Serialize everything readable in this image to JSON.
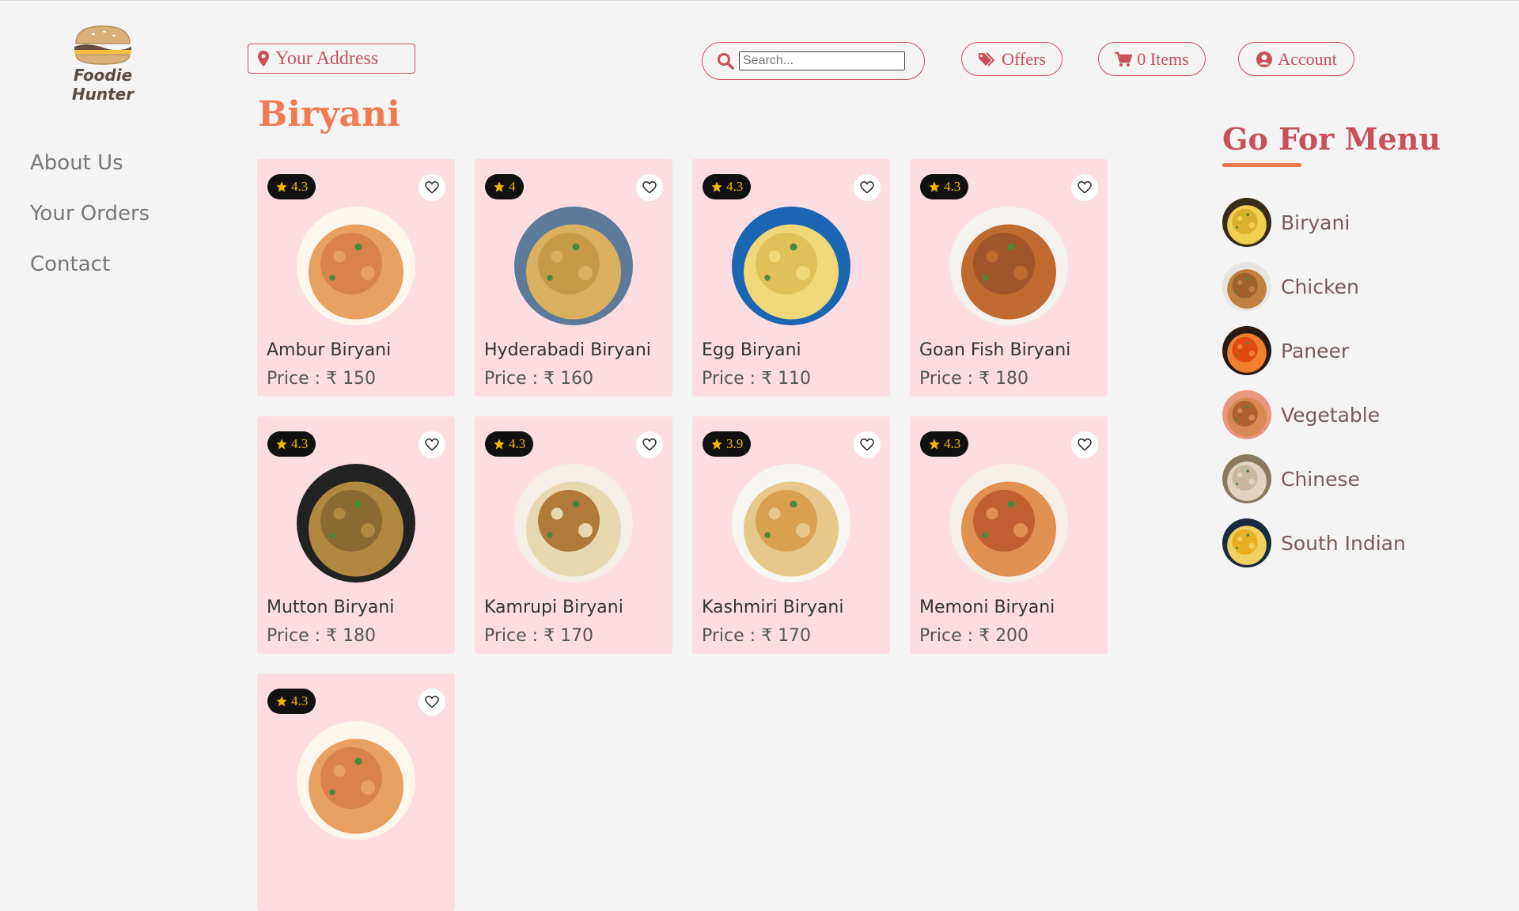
{
  "brand": {
    "name": "Foodie Hunter"
  },
  "header": {
    "address_label": "Your Address",
    "search_placeholder": "Search...",
    "offers_label": "Offers",
    "cart_label": "0 Items",
    "account_label": "Account"
  },
  "left_nav": [
    "About Us",
    "Your Orders",
    "Contact"
  ],
  "section_title": "Biryani",
  "price_prefix": "Price : ₹",
  "items": [
    {
      "name": "Ambur Biryani",
      "price": "150",
      "rating": "4.3",
      "palette": [
        "#d9824a",
        "#e8a060",
        "#fff6ee"
      ]
    },
    {
      "name": "Hyderabadi Biryani",
      "price": "160",
      "rating": "4",
      "palette": [
        "#c79a4a",
        "#d9b060",
        "#5c7a99"
      ]
    },
    {
      "name": "Egg Biryani",
      "price": "110",
      "rating": "4.3",
      "palette": [
        "#e0c058",
        "#f0d878",
        "#1b66b3"
      ]
    },
    {
      "name": "Goan Fish Biryani",
      "price": "180",
      "rating": "4.3",
      "palette": [
        "#a0552a",
        "#c06a30",
        "#f4f2ee"
      ]
    },
    {
      "name": "Mutton Biryani",
      "price": "180",
      "rating": "4.3",
      "palette": [
        "#8a6a30",
        "#b08840",
        "#222222"
      ]
    },
    {
      "name": "Kamrupi Biryani",
      "price": "170",
      "rating": "4.3",
      "palette": [
        "#b07a38",
        "#e8d8b0",
        "#f4eee6"
      ]
    },
    {
      "name": "Kashmiri Biryani",
      "price": "170",
      "rating": "3.9",
      "palette": [
        "#d8a050",
        "#e8c88a",
        "#f8f6f2"
      ]
    },
    {
      "name": "Memoni Biryani",
      "price": "200",
      "rating": "4.3",
      "palette": [
        "#c06030",
        "#e09050",
        "#f6efe8"
      ]
    },
    {
      "name": "",
      "price": "",
      "rating": "4.3",
      "palette": [
        "#d9824a",
        "#e8a060",
        "#fff6ee"
      ]
    }
  ],
  "menu": {
    "title": "Go For Menu",
    "items": [
      {
        "label": "Biryani",
        "palette": [
          "#d8b030",
          "#f0d050",
          "#3a2a1a"
        ]
      },
      {
        "label": "Chicken",
        "palette": [
          "#a0602a",
          "#c08040",
          "#e8e4e0"
        ]
      },
      {
        "label": "Paneer",
        "palette": [
          "#e04a10",
          "#f08030",
          "#2a1a10"
        ]
      },
      {
        "label": "Vegetable",
        "palette": [
          "#b06030",
          "#d88850",
          "#e89880"
        ]
      },
      {
        "label": "Chinese",
        "palette": [
          "#c8b8a0",
          "#e0d4c0",
          "#8a7a60"
        ]
      },
      {
        "label": "South Indian",
        "palette": [
          "#e8b020",
          "#f0d060",
          "#1a2a40"
        ]
      }
    ]
  },
  "colors": {
    "accent": "#c8505a",
    "title_orange": "#f07b50",
    "card_bg": "#fddde1",
    "star": "#f3b400"
  },
  "icons": [
    "burger-logo-icon",
    "map-marker-icon",
    "search-icon",
    "tag-icon",
    "cart-icon",
    "user-circle-icon",
    "star-icon",
    "heart-icon"
  ]
}
